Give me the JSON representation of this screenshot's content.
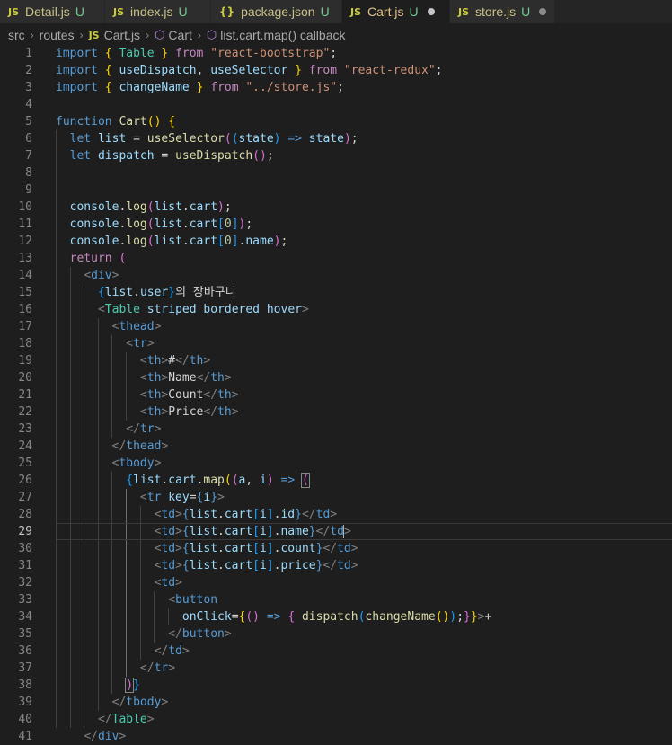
{
  "tabs": [
    {
      "icon": "JS",
      "name": "Detail.js",
      "status": "U",
      "active": false
    },
    {
      "icon": "JS",
      "name": "index.js",
      "status": "U",
      "active": false
    },
    {
      "icon": "{}",
      "name": "package.json",
      "status": "U",
      "active": false
    },
    {
      "icon": "JS",
      "name": "Cart.js",
      "status": "U",
      "active": true
    },
    {
      "icon": "JS",
      "name": "store.js",
      "status": "U",
      "active": false
    }
  ],
  "breadcrumb": {
    "src": "src",
    "routes": "routes",
    "file_icon": "JS",
    "file": "Cart.js",
    "symbol": "Cart",
    "callback": "list.cart.map() callback"
  },
  "editor": {
    "current_line": 29,
    "lines": [
      [
        [
          "kw",
          "import"
        ],
        [
          "txt",
          " "
        ],
        [
          "b1",
          "{"
        ],
        [
          "txt",
          " "
        ],
        [
          "cls",
          "Table"
        ],
        [
          "txt",
          " "
        ],
        [
          "b1",
          "}"
        ],
        [
          "txt",
          " "
        ],
        [
          "ctl",
          "from"
        ],
        [
          "txt",
          " "
        ],
        [
          "str",
          "\"react-bootstrap\""
        ],
        [
          "txt",
          ";"
        ]
      ],
      [
        [
          "kw",
          "import"
        ],
        [
          "txt",
          " "
        ],
        [
          "b1",
          "{"
        ],
        [
          "txt",
          " "
        ],
        [
          "var",
          "useDispatch"
        ],
        [
          "txt",
          ", "
        ],
        [
          "var",
          "useSelector"
        ],
        [
          "txt",
          " "
        ],
        [
          "b1",
          "}"
        ],
        [
          "txt",
          " "
        ],
        [
          "ctl",
          "from"
        ],
        [
          "txt",
          " "
        ],
        [
          "str",
          "\"react-redux\""
        ],
        [
          "txt",
          ";"
        ]
      ],
      [
        [
          "kw",
          "import"
        ],
        [
          "txt",
          " "
        ],
        [
          "b1",
          "{"
        ],
        [
          "txt",
          " "
        ],
        [
          "var",
          "changeName"
        ],
        [
          "txt",
          " "
        ],
        [
          "b1",
          "}"
        ],
        [
          "txt",
          " "
        ],
        [
          "ctl",
          "from"
        ],
        [
          "txt",
          " "
        ],
        [
          "str",
          "\"../store.js\""
        ],
        [
          "txt",
          ";"
        ]
      ],
      [],
      [
        [
          "kw",
          "function"
        ],
        [
          "txt",
          " "
        ],
        [
          "fn",
          "Cart"
        ],
        [
          "b1",
          "()"
        ],
        [
          "txt",
          " "
        ],
        [
          "b1",
          "{"
        ]
      ],
      [
        [
          "txt",
          "  "
        ],
        [
          "kw",
          "let"
        ],
        [
          "txt",
          " "
        ],
        [
          "var",
          "list"
        ],
        [
          "txt",
          " = "
        ],
        [
          "fn",
          "useSelector"
        ],
        [
          "b2",
          "("
        ],
        [
          "b3",
          "("
        ],
        [
          "var",
          "state"
        ],
        [
          "b3",
          ")"
        ],
        [
          "txt",
          " "
        ],
        [
          "kw",
          "=>"
        ],
        [
          "txt",
          " "
        ],
        [
          "var",
          "state"
        ],
        [
          "b2",
          ")"
        ],
        [
          "txt",
          ";"
        ]
      ],
      [
        [
          "txt",
          "  "
        ],
        [
          "kw",
          "let"
        ],
        [
          "txt",
          " "
        ],
        [
          "var",
          "dispatch"
        ],
        [
          "txt",
          " = "
        ],
        [
          "fn",
          "useDispatch"
        ],
        [
          "b2",
          "()"
        ],
        [
          "txt",
          ";"
        ]
      ],
      [],
      [],
      [
        [
          "txt",
          "  "
        ],
        [
          "var",
          "console"
        ],
        [
          "txt",
          "."
        ],
        [
          "fn",
          "log"
        ],
        [
          "b2",
          "("
        ],
        [
          "var",
          "list"
        ],
        [
          "txt",
          "."
        ],
        [
          "var",
          "cart"
        ],
        [
          "b2",
          ")"
        ],
        [
          "txt",
          ";"
        ]
      ],
      [
        [
          "txt",
          "  "
        ],
        [
          "var",
          "console"
        ],
        [
          "txt",
          "."
        ],
        [
          "fn",
          "log"
        ],
        [
          "b2",
          "("
        ],
        [
          "var",
          "list"
        ],
        [
          "txt",
          "."
        ],
        [
          "var",
          "cart"
        ],
        [
          "b3",
          "["
        ],
        [
          "num",
          "0"
        ],
        [
          "b3",
          "]"
        ],
        [
          "b2",
          ")"
        ],
        [
          "txt",
          ";"
        ]
      ],
      [
        [
          "txt",
          "  "
        ],
        [
          "var",
          "console"
        ],
        [
          "txt",
          "."
        ],
        [
          "fn",
          "log"
        ],
        [
          "b2",
          "("
        ],
        [
          "var",
          "list"
        ],
        [
          "txt",
          "."
        ],
        [
          "var",
          "cart"
        ],
        [
          "b3",
          "["
        ],
        [
          "num",
          "0"
        ],
        [
          "b3",
          "]"
        ],
        [
          "txt",
          "."
        ],
        [
          "var",
          "name"
        ],
        [
          "b2",
          ")"
        ],
        [
          "txt",
          ";"
        ]
      ],
      [
        [
          "txt",
          "  "
        ],
        [
          "ctl",
          "return"
        ],
        [
          "txt",
          " "
        ],
        [
          "b2",
          "("
        ]
      ],
      [
        [
          "txt",
          "    "
        ],
        [
          "pun",
          "<"
        ],
        [
          "tg",
          "div"
        ],
        [
          "pun",
          ">"
        ]
      ],
      [
        [
          "txt",
          "      "
        ],
        [
          "b3",
          "{"
        ],
        [
          "var",
          "list"
        ],
        [
          "txt",
          "."
        ],
        [
          "var",
          "user"
        ],
        [
          "b3",
          "}"
        ],
        [
          "txt",
          "의 장바구니"
        ]
      ],
      [
        [
          "txt",
          "      "
        ],
        [
          "pun",
          "<"
        ],
        [
          "cls",
          "Table"
        ],
        [
          "txt",
          " "
        ],
        [
          "attr",
          "striped"
        ],
        [
          "txt",
          " "
        ],
        [
          "attr",
          "bordered"
        ],
        [
          "txt",
          " "
        ],
        [
          "attr",
          "hover"
        ],
        [
          "pun",
          ">"
        ]
      ],
      [
        [
          "txt",
          "        "
        ],
        [
          "pun",
          "<"
        ],
        [
          "tg",
          "thead"
        ],
        [
          "pun",
          ">"
        ]
      ],
      [
        [
          "txt",
          "          "
        ],
        [
          "pun",
          "<"
        ],
        [
          "tg",
          "tr"
        ],
        [
          "pun",
          ">"
        ]
      ],
      [
        [
          "txt",
          "            "
        ],
        [
          "pun",
          "<"
        ],
        [
          "tg",
          "th"
        ],
        [
          "pun",
          ">"
        ],
        [
          "txt",
          "#"
        ],
        [
          "pun",
          "</"
        ],
        [
          "tg",
          "th"
        ],
        [
          "pun",
          ">"
        ]
      ],
      [
        [
          "txt",
          "            "
        ],
        [
          "pun",
          "<"
        ],
        [
          "tg",
          "th"
        ],
        [
          "pun",
          ">"
        ],
        [
          "txt",
          "Name"
        ],
        [
          "pun",
          "</"
        ],
        [
          "tg",
          "th"
        ],
        [
          "pun",
          ">"
        ]
      ],
      [
        [
          "txt",
          "            "
        ],
        [
          "pun",
          "<"
        ],
        [
          "tg",
          "th"
        ],
        [
          "pun",
          ">"
        ],
        [
          "txt",
          "Count"
        ],
        [
          "pun",
          "</"
        ],
        [
          "tg",
          "th"
        ],
        [
          "pun",
          ">"
        ]
      ],
      [
        [
          "txt",
          "            "
        ],
        [
          "pun",
          "<"
        ],
        [
          "tg",
          "th"
        ],
        [
          "pun",
          ">"
        ],
        [
          "txt",
          "Price"
        ],
        [
          "pun",
          "</"
        ],
        [
          "tg",
          "th"
        ],
        [
          "pun",
          ">"
        ]
      ],
      [
        [
          "txt",
          "          "
        ],
        [
          "pun",
          "</"
        ],
        [
          "tg",
          "tr"
        ],
        [
          "pun",
          ">"
        ]
      ],
      [
        [
          "txt",
          "        "
        ],
        [
          "pun",
          "</"
        ],
        [
          "tg",
          "thead"
        ],
        [
          "pun",
          ">"
        ]
      ],
      [
        [
          "txt",
          "        "
        ],
        [
          "pun",
          "<"
        ],
        [
          "tg",
          "tbody"
        ],
        [
          "pun",
          ">"
        ]
      ],
      [
        [
          "txt",
          "          "
        ],
        [
          "b3",
          "{"
        ],
        [
          "var",
          "list"
        ],
        [
          "txt",
          "."
        ],
        [
          "var",
          "cart"
        ],
        [
          "txt",
          "."
        ],
        [
          "fn",
          "map"
        ],
        [
          "b1",
          "("
        ],
        [
          "b2",
          "("
        ],
        [
          "var",
          "a"
        ],
        [
          "txt",
          ", "
        ],
        [
          "var",
          "i"
        ],
        [
          "b2",
          ")"
        ],
        [
          "txt",
          " "
        ],
        [
          "kw",
          "=>"
        ],
        [
          "txt",
          " "
        ],
        [
          "b2 mb",
          "("
        ]
      ],
      [
        [
          "txt",
          "            "
        ],
        [
          "pun",
          "<"
        ],
        [
          "tg",
          "tr"
        ],
        [
          "txt",
          " "
        ],
        [
          "attr",
          "key"
        ],
        [
          "txt",
          "="
        ],
        [
          "kw",
          "{"
        ],
        [
          "var",
          "i"
        ],
        [
          "kw",
          "}"
        ],
        [
          "pun",
          ">"
        ]
      ],
      [
        [
          "txt",
          "              "
        ],
        [
          "pun",
          "<"
        ],
        [
          "tg",
          "td"
        ],
        [
          "pun",
          ">"
        ],
        [
          "kw",
          "{"
        ],
        [
          "var",
          "list"
        ],
        [
          "txt",
          "."
        ],
        [
          "var",
          "cart"
        ],
        [
          "b3",
          "["
        ],
        [
          "var",
          "i"
        ],
        [
          "b3",
          "]"
        ],
        [
          "txt",
          "."
        ],
        [
          "var",
          "id"
        ],
        [
          "kw",
          "}"
        ],
        [
          "pun",
          "</"
        ],
        [
          "tg",
          "td"
        ],
        [
          "pun",
          ">"
        ]
      ],
      [
        [
          "txt",
          "              "
        ],
        [
          "pun",
          "<"
        ],
        [
          "tg",
          "td"
        ],
        [
          "pun",
          ">"
        ],
        [
          "kw",
          "{"
        ],
        [
          "var",
          "list"
        ],
        [
          "txt",
          "."
        ],
        [
          "var",
          "cart"
        ],
        [
          "b3",
          "["
        ],
        [
          "var",
          "i"
        ],
        [
          "b3",
          "]"
        ],
        [
          "txt",
          "."
        ],
        [
          "var",
          "name"
        ],
        [
          "kw",
          "}"
        ],
        [
          "pun",
          "</"
        ],
        [
          "tg",
          "td"
        ],
        [
          "pun caret",
          ">"
        ]
      ],
      [
        [
          "txt",
          "              "
        ],
        [
          "pun",
          "<"
        ],
        [
          "tg",
          "td"
        ],
        [
          "pun",
          ">"
        ],
        [
          "kw",
          "{"
        ],
        [
          "var",
          "list"
        ],
        [
          "txt",
          "."
        ],
        [
          "var",
          "cart"
        ],
        [
          "b3",
          "["
        ],
        [
          "var",
          "i"
        ],
        [
          "b3",
          "]"
        ],
        [
          "txt",
          "."
        ],
        [
          "var",
          "count"
        ],
        [
          "kw",
          "}"
        ],
        [
          "pun",
          "</"
        ],
        [
          "tg",
          "td"
        ],
        [
          "pun",
          ">"
        ]
      ],
      [
        [
          "txt",
          "              "
        ],
        [
          "pun",
          "<"
        ],
        [
          "tg",
          "td"
        ],
        [
          "pun",
          ">"
        ],
        [
          "kw",
          "{"
        ],
        [
          "var",
          "list"
        ],
        [
          "txt",
          "."
        ],
        [
          "var",
          "cart"
        ],
        [
          "b3",
          "["
        ],
        [
          "var",
          "i"
        ],
        [
          "b3",
          "]"
        ],
        [
          "txt",
          "."
        ],
        [
          "var",
          "price"
        ],
        [
          "kw",
          "}"
        ],
        [
          "pun",
          "</"
        ],
        [
          "tg",
          "td"
        ],
        [
          "pun",
          ">"
        ]
      ],
      [
        [
          "txt",
          "              "
        ],
        [
          "pun",
          "<"
        ],
        [
          "tg",
          "td"
        ],
        [
          "pun",
          ">"
        ]
      ],
      [
        [
          "txt",
          "                "
        ],
        [
          "pun",
          "<"
        ],
        [
          "tg",
          "button"
        ]
      ],
      [
        [
          "txt",
          "                  "
        ],
        [
          "attr",
          "onClick"
        ],
        [
          "txt",
          "="
        ],
        [
          "b1",
          "{"
        ],
        [
          "b2",
          "()"
        ],
        [
          "txt",
          " "
        ],
        [
          "kw",
          "=>"
        ],
        [
          "txt",
          " "
        ],
        [
          "b2",
          "{"
        ],
        [
          "txt",
          " "
        ],
        [
          "fn",
          "dispatch"
        ],
        [
          "b3",
          "("
        ],
        [
          "fn",
          "changeName"
        ],
        [
          "b1",
          "()"
        ],
        [
          "b3",
          ")"
        ],
        [
          "txt",
          ";"
        ],
        [
          "b2",
          "}"
        ],
        [
          "b1",
          "}"
        ],
        [
          "pun",
          ">"
        ],
        [
          "txt",
          "+"
        ]
      ],
      [
        [
          "txt",
          "                "
        ],
        [
          "pun",
          "</"
        ],
        [
          "tg",
          "button"
        ],
        [
          "pun",
          ">"
        ]
      ],
      [
        [
          "txt",
          "              "
        ],
        [
          "pun",
          "</"
        ],
        [
          "tg",
          "td"
        ],
        [
          "pun",
          ">"
        ]
      ],
      [
        [
          "txt",
          "            "
        ],
        [
          "pun",
          "</"
        ],
        [
          "tg",
          "tr"
        ],
        [
          "pun",
          ">"
        ]
      ],
      [
        [
          "txt",
          "          "
        ],
        [
          "b2 mb",
          ")"
        ],
        [
          "b3",
          "}"
        ]
      ],
      [
        [
          "txt",
          "        "
        ],
        [
          "pun",
          "</"
        ],
        [
          "tg",
          "tbody"
        ],
        [
          "pun",
          ">"
        ]
      ],
      [
        [
          "txt",
          "      "
        ],
        [
          "pun",
          "</"
        ],
        [
          "cls",
          "Table"
        ],
        [
          "pun",
          ">"
        ]
      ],
      [
        [
          "txt",
          "    "
        ],
        [
          "pun",
          "</"
        ],
        [
          "tg",
          "div"
        ],
        [
          "pun",
          ">"
        ]
      ]
    ]
  }
}
